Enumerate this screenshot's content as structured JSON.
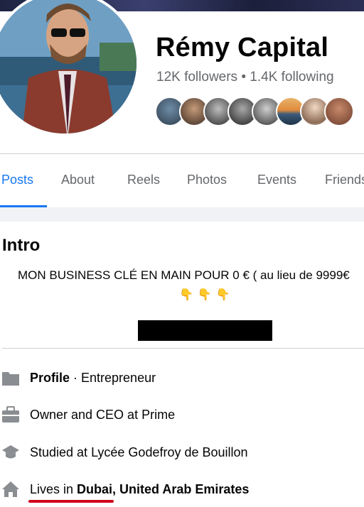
{
  "profile": {
    "name": "Rémy Capital",
    "followers": "12K followers",
    "separator": "•",
    "following": "1.4K following"
  },
  "tabs": [
    {
      "label": "Posts",
      "active": true
    },
    {
      "label": "About"
    },
    {
      "label": "Reels"
    },
    {
      "label": "Photos"
    },
    {
      "label": "Events"
    },
    {
      "label": "Friends"
    }
  ],
  "intro": {
    "title": "Intro",
    "bio": "MON BUSINESS CLÉ EN MAIN POUR 0 € ( au lieu de 9999€",
    "emojis": [
      "👇",
      "👇",
      "👇"
    ]
  },
  "details": {
    "profile_label": "Profile",
    "profile_sep": " · ",
    "profile_value": "Entrepreneur",
    "work": "Owner and CEO at Prime",
    "education": "Studied at Lycée Godefroy de Bouillon",
    "lives_prefix": "Lives in ",
    "lives_place": "Dubai, United Arab Emirates"
  },
  "icons": [
    "folder-icon",
    "briefcase-icon",
    "graduation-cap-icon",
    "home-icon"
  ],
  "colors": {
    "accent": "#1877f2",
    "secondary_text": "#65676b",
    "annotation": "#d0021b"
  }
}
